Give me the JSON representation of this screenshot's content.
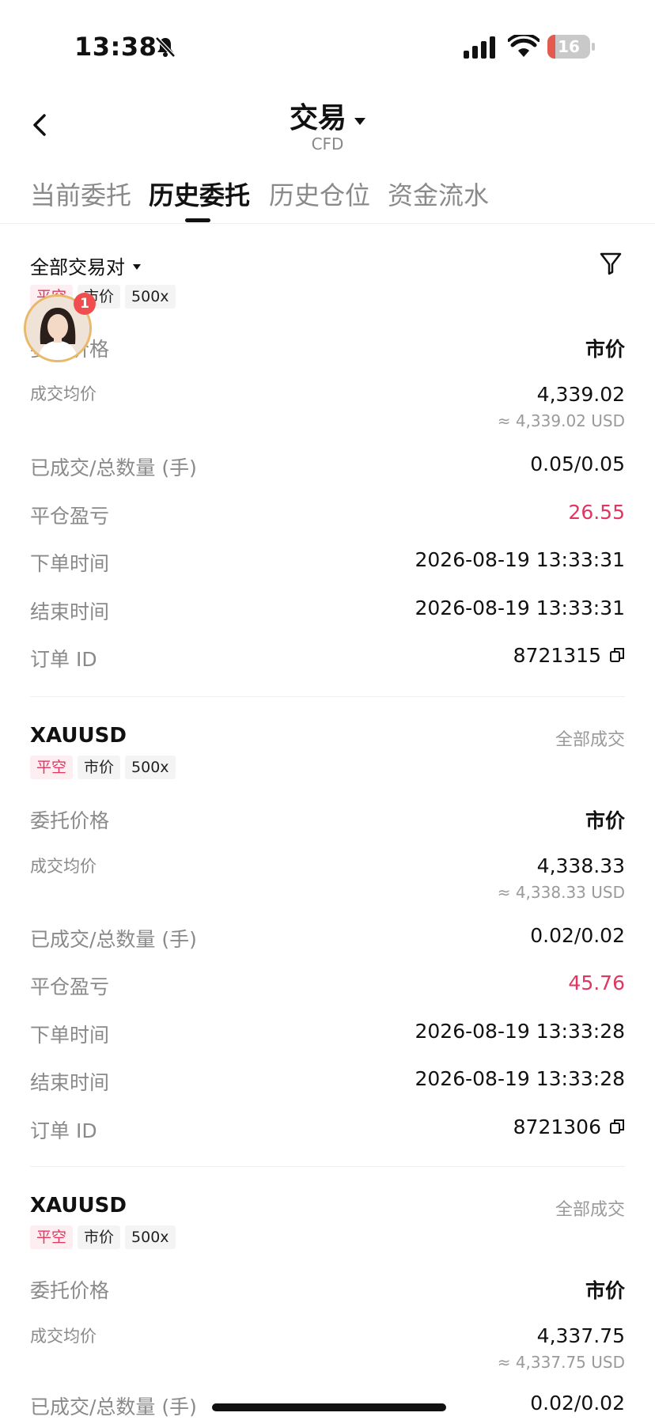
{
  "status_bar": {
    "time": "13:38",
    "battery": "16",
    "battery_level": 0.16
  },
  "nav": {
    "title": "交易",
    "subtitle": "CFD"
  },
  "tabs": [
    {
      "label": "当前委托",
      "active": false
    },
    {
      "label": "历史委托",
      "active": true
    },
    {
      "label": "历史仓位",
      "active": false
    },
    {
      "label": "资金流水",
      "active": false
    }
  ],
  "filter": {
    "label": "全部交易对"
  },
  "avatar": {
    "badge": "1"
  },
  "orders": [
    {
      "symbol": "",
      "status": "",
      "tags": [
        "平空",
        "市价",
        "500x"
      ],
      "fields": {
        "order_price": {
          "label": "委托价格",
          "value": "市价"
        },
        "avg_price": {
          "label": "成交均价",
          "value": "4,339.02",
          "approx": "≈ 4,339.02 USD"
        },
        "filled_total": {
          "label": "已成交/总数量 (手)",
          "value": "0.05/0.05"
        },
        "pnl": {
          "label": "平仓盈亏",
          "value": "26.55"
        },
        "order_time": {
          "label": "下单时间",
          "value": "2026-08-19 13:33:31"
        },
        "end_time": {
          "label": "结束时间",
          "value": "2026-08-19 13:33:31"
        },
        "order_id": {
          "label": "订单 ID",
          "value": "8721315"
        }
      }
    },
    {
      "symbol": "XAUUSD",
      "status": "全部成交",
      "tags": [
        "平空",
        "市价",
        "500x"
      ],
      "fields": {
        "order_price": {
          "label": "委托价格",
          "value": "市价"
        },
        "avg_price": {
          "label": "成交均价",
          "value": "4,338.33",
          "approx": "≈ 4,338.33 USD"
        },
        "filled_total": {
          "label": "已成交/总数量 (手)",
          "value": "0.02/0.02"
        },
        "pnl": {
          "label": "平仓盈亏",
          "value": "45.76"
        },
        "order_time": {
          "label": "下单时间",
          "value": "2026-08-19 13:33:28"
        },
        "end_time": {
          "label": "结束时间",
          "value": "2026-08-19 13:33:28"
        },
        "order_id": {
          "label": "订单 ID",
          "value": "8721306"
        }
      }
    },
    {
      "symbol": "XAUUSD",
      "status": "全部成交",
      "tags": [
        "平空",
        "市价",
        "500x"
      ],
      "fields": {
        "order_price": {
          "label": "委托价格",
          "value": "市价"
        },
        "avg_price": {
          "label": "成交均价",
          "value": "4,337.75",
          "approx": "≈ 4,337.75 USD"
        },
        "filled_total": {
          "label": "已成交/总数量 (手)",
          "value": "0.02/0.02"
        }
      }
    }
  ],
  "colors": {
    "loss_profit_red": "#e0365f",
    "tag_red_bg": "#fdeef1",
    "tab_indicator": "#111111",
    "badge_red": "#f04e4e",
    "avatar_ring": "#e8b969"
  }
}
